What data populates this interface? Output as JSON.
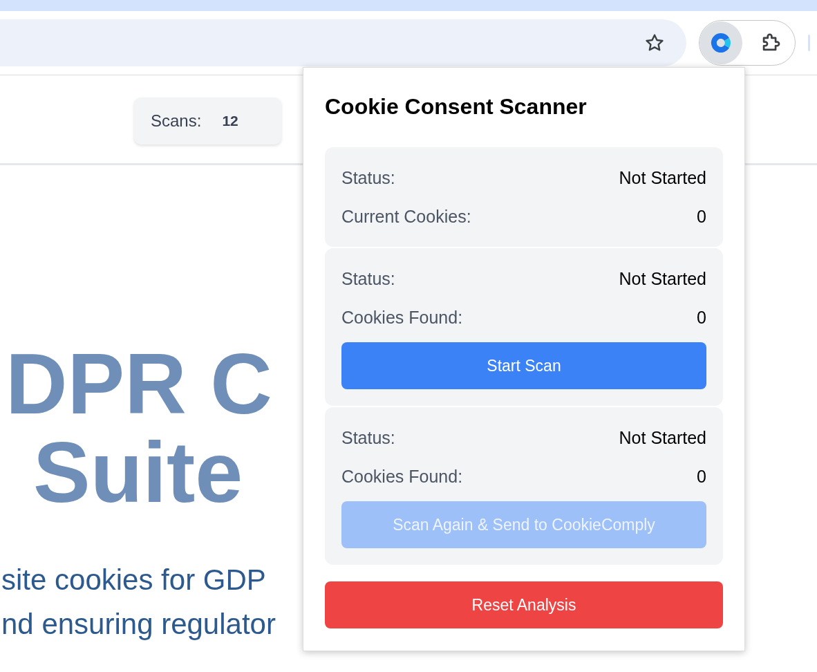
{
  "page": {
    "scans_label": "Scans:",
    "scans_count": "12",
    "heading_lines": [
      "DPR C",
      "Suite"
    ],
    "subtitle_lines": [
      "site cookies for GDP",
      "nd ensuring regulator"
    ]
  },
  "popup": {
    "title": "Cookie Consent Scanner",
    "sections": [
      {
        "rows": [
          {
            "label": "Status:",
            "value": "Not Started"
          },
          {
            "label": "Current Cookies:",
            "value": "0"
          }
        ]
      },
      {
        "rows": [
          {
            "label": "Status:",
            "value": "Not Started"
          },
          {
            "label": "Cookies Found:",
            "value": "0"
          }
        ],
        "button": {
          "label": "Start Scan",
          "disabled": false
        }
      },
      {
        "rows": [
          {
            "label": "Status:",
            "value": "Not Started"
          },
          {
            "label": "Cookies Found:",
            "value": "0"
          }
        ],
        "button": {
          "label": "Scan Again & Send to CookieComply",
          "disabled": true
        }
      }
    ],
    "reset_button": "Reset Analysis"
  }
}
